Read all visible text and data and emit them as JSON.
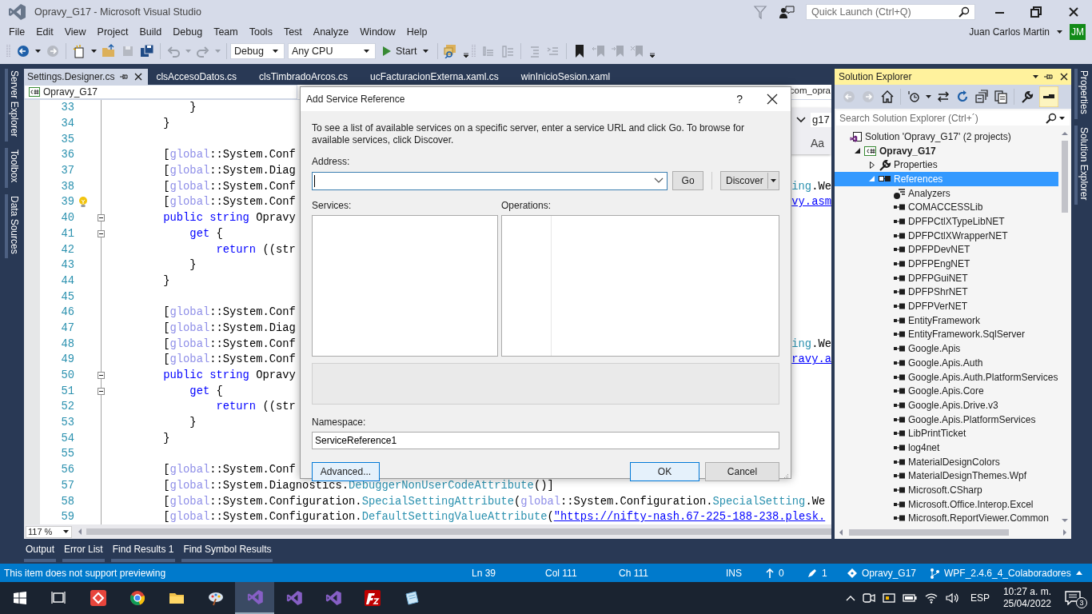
{
  "window": {
    "title": "Opravy_G17 - Microsoft Visual Studio",
    "quick_launch": {
      "placeholder": "Quick Launch (Ctrl+Q)"
    }
  },
  "menu": [
    "File",
    "Edit",
    "View",
    "Project",
    "Build",
    "Debug",
    "Team",
    "Tools",
    "Test",
    "Analyze",
    "Window",
    "Help"
  ],
  "account": {
    "name": "Juan Carlos Martin",
    "initials": "JM"
  },
  "toolbar": {
    "configuration": "Debug",
    "platform": "Any CPU",
    "start": "Start"
  },
  "left_tool_tabs": [
    "Server Explorer",
    "Toolbox",
    "Data Sources"
  ],
  "document_tabs": [
    {
      "label": "Settings.Designer.cs",
      "selected": true
    },
    {
      "label": "clsAccesoDatos.cs",
      "selected": false
    },
    {
      "label": "clsTimbradoArcos.cs",
      "selected": false
    },
    {
      "label": "ucFacturacionExterna.xaml.cs",
      "selected": false
    },
    {
      "label": "winInicioSesion.xaml",
      "selected": false
    }
  ],
  "editor": {
    "project": "Opravy_G17",
    "member": "com_opra",
    "find": {
      "value": "g17",
      "match_case": "Aa"
    },
    "zoom": "117 %",
    "lines": [
      {
        "number": "33",
        "tokens": [
          {
            "kind": "plain",
            "text": "            }"
          }
        ]
      },
      {
        "number": "34",
        "tokens": [
          {
            "kind": "plain",
            "text": "        }"
          }
        ]
      },
      {
        "number": "35"
      },
      {
        "number": "36",
        "tokens": [
          {
            "kind": "plain",
            "text": "        ["
          },
          {
            "kind": "global",
            "text": "global"
          },
          {
            "kind": "plain",
            "text": "::System.Conf"
          }
        ]
      },
      {
        "number": "37",
        "tokens": [
          {
            "kind": "plain",
            "text": "        ["
          },
          {
            "kind": "global",
            "text": "global"
          },
          {
            "kind": "plain",
            "text": "::System.Diag"
          }
        ]
      },
      {
        "number": "38",
        "tokens": [
          {
            "kind": "plain",
            "text": "        ["
          },
          {
            "kind": "global",
            "text": "global"
          },
          {
            "kind": "plain",
            "text": "::System.Conf"
          }
        ],
        "tail": [
          {
            "kind": "type",
            "text": "ing"
          },
          {
            "kind": "plain",
            "text": ".We"
          }
        ]
      },
      {
        "number": "39",
        "lightbulb": true,
        "tokens": [
          {
            "kind": "plain",
            "text": "        ["
          },
          {
            "kind": "global",
            "text": "global"
          },
          {
            "kind": "plain",
            "text": "::System.Conf"
          }
        ],
        "tail": [
          {
            "kind": "link",
            "text": "vy.asm"
          }
        ]
      },
      {
        "number": "40",
        "fold_marker": true,
        "tokens": [
          {
            "kind": "keyword",
            "text": "        public"
          },
          {
            "kind": "keyword",
            "text": " string"
          },
          {
            "kind": "plain",
            "text": " Opravy"
          }
        ]
      },
      {
        "number": "41",
        "fold_marker": true,
        "tokens": [
          {
            "kind": "keyword",
            "text": "            get"
          },
          {
            "kind": "plain",
            "text": " {"
          }
        ]
      },
      {
        "number": "42",
        "tokens": [
          {
            "kind": "keyword",
            "text": "                return"
          },
          {
            "kind": "plain",
            "text": " ((str"
          }
        ]
      },
      {
        "number": "43",
        "tokens": [
          {
            "kind": "plain",
            "text": "            }"
          }
        ]
      },
      {
        "number": "44",
        "tokens": [
          {
            "kind": "plain",
            "text": "        }"
          }
        ]
      },
      {
        "number": "45"
      },
      {
        "number": "46",
        "tokens": [
          {
            "kind": "plain",
            "text": "        ["
          },
          {
            "kind": "global",
            "text": "global"
          },
          {
            "kind": "plain",
            "text": "::System.Conf"
          }
        ]
      },
      {
        "number": "47",
        "tokens": [
          {
            "kind": "plain",
            "text": "        ["
          },
          {
            "kind": "global",
            "text": "global"
          },
          {
            "kind": "plain",
            "text": "::System.Diag"
          }
        ]
      },
      {
        "number": "48",
        "tokens": [
          {
            "kind": "plain",
            "text": "        ["
          },
          {
            "kind": "global",
            "text": "global"
          },
          {
            "kind": "plain",
            "text": "::System.Conf"
          }
        ],
        "tail": [
          {
            "kind": "type",
            "text": "ing"
          },
          {
            "kind": "plain",
            "text": ".We"
          }
        ]
      },
      {
        "number": "49",
        "tokens": [
          {
            "kind": "plain",
            "text": "        ["
          },
          {
            "kind": "global",
            "text": "global"
          },
          {
            "kind": "plain",
            "text": "::System.Conf"
          }
        ],
        "tail": [
          {
            "kind": "link",
            "text": "ravy.a"
          }
        ]
      },
      {
        "number": "50",
        "fold_marker": true,
        "tokens": [
          {
            "kind": "keyword",
            "text": "        public"
          },
          {
            "kind": "keyword",
            "text": " string"
          },
          {
            "kind": "plain",
            "text": " Opravy"
          }
        ]
      },
      {
        "number": "51",
        "fold_marker": true,
        "tokens": [
          {
            "kind": "keyword",
            "text": "            get"
          },
          {
            "kind": "plain",
            "text": " {"
          }
        ]
      },
      {
        "number": "52",
        "tokens": [
          {
            "kind": "keyword",
            "text": "                return"
          },
          {
            "kind": "plain",
            "text": " ((str"
          }
        ]
      },
      {
        "number": "53",
        "tokens": [
          {
            "kind": "plain",
            "text": "            }"
          }
        ]
      },
      {
        "number": "54",
        "tokens": [
          {
            "kind": "plain",
            "text": "        }"
          }
        ]
      },
      {
        "number": "55"
      },
      {
        "number": "56",
        "tokens": [
          {
            "kind": "plain",
            "text": "        ["
          },
          {
            "kind": "global",
            "text": "global"
          },
          {
            "kind": "plain",
            "text": "::System.Conf"
          }
        ]
      },
      {
        "number": "57",
        "tokens": [
          {
            "kind": "plain",
            "text": "        ["
          },
          {
            "kind": "global",
            "text": "global"
          },
          {
            "kind": "plain",
            "text": "::System.Diagnostics."
          },
          {
            "kind": "type",
            "text": "DebuggerNonUserCodeAttribute"
          },
          {
            "kind": "plain",
            "text": "()]"
          }
        ]
      },
      {
        "number": "58",
        "tokens": [
          {
            "kind": "plain",
            "text": "        ["
          },
          {
            "kind": "global",
            "text": "global"
          },
          {
            "kind": "plain",
            "text": "::System.Configuration."
          },
          {
            "kind": "type",
            "text": "SpecialSettingAttribute"
          },
          {
            "kind": "plain",
            "text": "("
          },
          {
            "kind": "global",
            "text": "global"
          },
          {
            "kind": "plain",
            "text": "::System.Configuration."
          },
          {
            "kind": "type",
            "text": "SpecialSetting"
          },
          {
            "kind": "plain",
            "text": ".We"
          }
        ]
      },
      {
        "number": "59",
        "tokens": [
          {
            "kind": "plain",
            "text": "        ["
          },
          {
            "kind": "global",
            "text": "global"
          },
          {
            "kind": "plain",
            "text": "::System.Configuration."
          },
          {
            "kind": "type",
            "text": "DefaultSettingValueAttribute"
          },
          {
            "kind": "plain",
            "text": "("
          },
          {
            "kind": "link",
            "text": "\"https://nifty-nash.67-225-188-238.plesk."
          }
        ]
      }
    ]
  },
  "dialog": {
    "title": "Add Service Reference",
    "help": "?",
    "description": "To see a list of available services on a specific server, enter a service URL and click Go. To browse for available services, click Discover.",
    "address_label": "Address:",
    "go": "Go",
    "discover": "Discover",
    "services_label": "Services:",
    "operations_label": "Operations:",
    "namespace_label": "Namespace:",
    "namespace": "ServiceReference1",
    "advanced": "Advanced...",
    "ok": "OK",
    "cancel": "Cancel"
  },
  "solution_explorer": {
    "title": "Solution Explorer",
    "search": {
      "placeholder": "Search Solution Explorer (Ctrl+´)"
    },
    "tree": [
      {
        "kind": "solution",
        "label": "Solution 'Opravy_G17' (2 projects)",
        "selected": false,
        "children": [
          {
            "kind": "project",
            "label": "Opravy_G17",
            "expanded": true,
            "selected": false,
            "children": [
              {
                "kind": "properties",
                "label": "Properties",
                "expanded": false,
                "selected": false
              },
              {
                "kind": "references",
                "label": "References",
                "expanded": true,
                "selected": true,
                "children": [
                  {
                    "kind": "analyzers",
                    "label": "Analyzers",
                    "selected": false
                  },
                  {
                    "kind": "reference",
                    "label": "COMACCESSLib",
                    "selected": false
                  },
                  {
                    "kind": "reference",
                    "label": "DPFPCtlXTypeLibNET",
                    "selected": false
                  },
                  {
                    "kind": "reference",
                    "label": "DPFPCtlXWrapperNET",
                    "selected": false
                  },
                  {
                    "kind": "reference",
                    "label": "DPFPDevNET",
                    "selected": false
                  },
                  {
                    "kind": "reference",
                    "label": "DPFPEngNET",
                    "selected": false
                  },
                  {
                    "kind": "reference",
                    "label": "DPFPGuiNET",
                    "selected": false
                  },
                  {
                    "kind": "reference",
                    "label": "DPFPShrNET",
                    "selected": false
                  },
                  {
                    "kind": "reference",
                    "label": "DPFPVerNET",
                    "selected": false
                  },
                  {
                    "kind": "reference",
                    "label": "EntityFramework",
                    "selected": false
                  },
                  {
                    "kind": "reference",
                    "label": "EntityFramework.SqlServer",
                    "selected": false
                  },
                  {
                    "kind": "reference",
                    "label": "Google.Apis",
                    "selected": false
                  },
                  {
                    "kind": "reference",
                    "label": "Google.Apis.Auth",
                    "selected": false
                  },
                  {
                    "kind": "reference",
                    "label": "Google.Apis.Auth.PlatformServices",
                    "selected": false
                  },
                  {
                    "kind": "reference",
                    "label": "Google.Apis.Core",
                    "selected": false
                  },
                  {
                    "kind": "reference",
                    "label": "Google.Apis.Drive.v3",
                    "selected": false
                  },
                  {
                    "kind": "reference",
                    "label": "Google.Apis.PlatformServices",
                    "selected": false
                  },
                  {
                    "kind": "reference",
                    "label": "LibPrintTicket",
                    "selected": false
                  },
                  {
                    "kind": "reference",
                    "label": "log4net",
                    "selected": false
                  },
                  {
                    "kind": "reference",
                    "label": "MaterialDesignColors",
                    "selected": false
                  },
                  {
                    "kind": "reference",
                    "label": "MaterialDesignThemes.Wpf",
                    "selected": false
                  },
                  {
                    "kind": "reference",
                    "label": "Microsoft.CSharp",
                    "selected": false
                  },
                  {
                    "kind": "reference",
                    "label": "Microsoft.Office.Interop.Excel",
                    "selected": false
                  },
                  {
                    "kind": "reference",
                    "label": "Microsoft.ReportViewer.Common",
                    "selected": false
                  }
                ]
              }
            ]
          }
        ]
      }
    ]
  },
  "right_tool_tabs": [
    "Properties",
    "Solution Explorer"
  ],
  "bottom_tool_tabs": [
    "Output",
    "Error List",
    "Find Results 1",
    "Find Symbol Results"
  ],
  "status_bar": {
    "message": "This item does not support previewing",
    "line": "Ln 39",
    "column": "Col 111",
    "char": "Ch 111",
    "mode": "INS",
    "pushes": "0",
    "changes": "1",
    "repository": "Opravy_G17",
    "branch": "WPF_2.4.6_4_Colaboradores"
  },
  "taskbar": {
    "apps": [
      {
        "kind": "taskview",
        "selected": false
      },
      {
        "kind": "diamond",
        "selected": false
      },
      {
        "kind": "browser",
        "selected": false
      },
      {
        "kind": "folder",
        "selected": false
      },
      {
        "kind": "paint",
        "selected": false
      },
      {
        "kind": "studio",
        "selected": true
      },
      {
        "kind": "studio",
        "selected": false
      },
      {
        "kind": "studio",
        "selected": false
      },
      {
        "kind": "ftp",
        "selected": false
      },
      {
        "kind": "notepad",
        "selected": false
      }
    ],
    "language": "ESP",
    "time": "10:27 a. m.",
    "date": "25/04/2022",
    "notifications": "3"
  }
}
